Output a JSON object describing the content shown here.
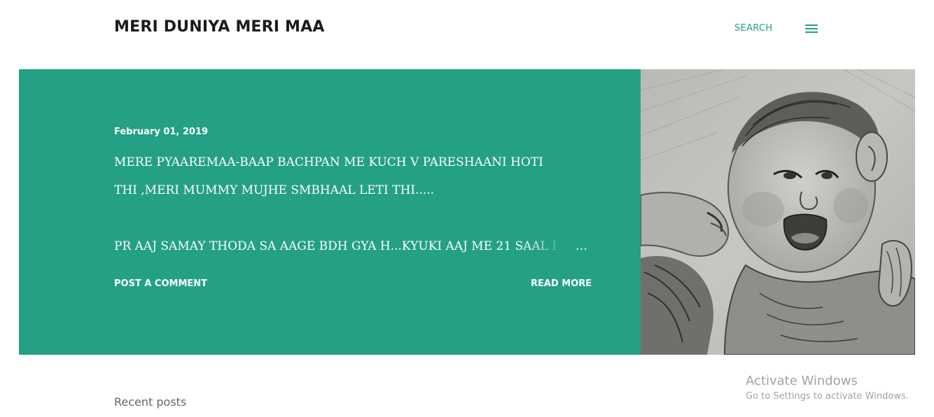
{
  "header": {
    "site_title": "MERI DUNIYA MERI MAA",
    "search_label": "SEARCH",
    "menu_icon": "hamburger-menu-icon"
  },
  "featured_post": {
    "date": "February 01, 2019",
    "lines": [
      "MERE PYAAREMAA-BAAP BACHPAN ME KUCH V PARESHAANI HOTI",
      "THI ,MERI MUMMY MUJHE SMBHAAL LETI THI.....",
      "PR AAJ SAMAY THODA SA AAGE BDH GYA H...KYUKI AAJ ME 21 SAAL I"
    ],
    "ellipsis": "…",
    "comment_label": "POST A COMMENT",
    "read_more_label": "READ MORE",
    "image_description": "pencil-sketch-mother-kissing-baby"
  },
  "recent_posts_label": "Recent posts",
  "watermark": {
    "title": "Activate Windows",
    "subtitle": "Go to Settings to activate Windows."
  },
  "colors": {
    "accent": "#24a085",
    "title_text": "#1b1b1b",
    "muted_text": "#666666",
    "watermark_text": "#a3a3a3"
  }
}
